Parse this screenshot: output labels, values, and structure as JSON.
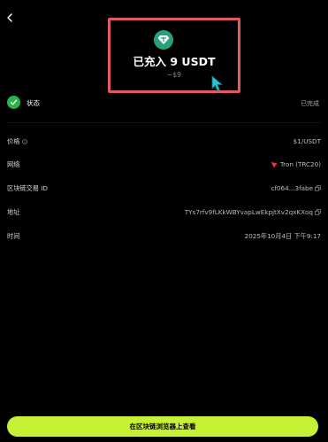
{
  "header": {
    "headline": "已充入 9 USDT",
    "fiat_value": "~$9",
    "token_icon": "tether-diamond-icon",
    "token_color": "#26a17b",
    "highlight_color": "#e05a5f"
  },
  "status": {
    "label": "状态",
    "value": "已完成",
    "icon": "check-circle-icon",
    "color": "#2bb34a"
  },
  "details": {
    "price": {
      "label": "价格",
      "value": "$1/USDT"
    },
    "network": {
      "label": "网络",
      "value": "Tron (TRC20)",
      "icon": "tron-icon",
      "icon_color": "#e8343a"
    },
    "tx_id": {
      "label": "区块链交易 ID",
      "value": "cf064...3fabe"
    },
    "address": {
      "label": "地址",
      "value": "TYs7rfv9fLKkWBYvapLwEkpjtXv2qxKXoq"
    },
    "time": {
      "label": "时间",
      "value": "2025年10月4日 下午9:17"
    }
  },
  "footer": {
    "button_label": "在区块链浏览器上查看",
    "button_color": "#c6f135"
  }
}
